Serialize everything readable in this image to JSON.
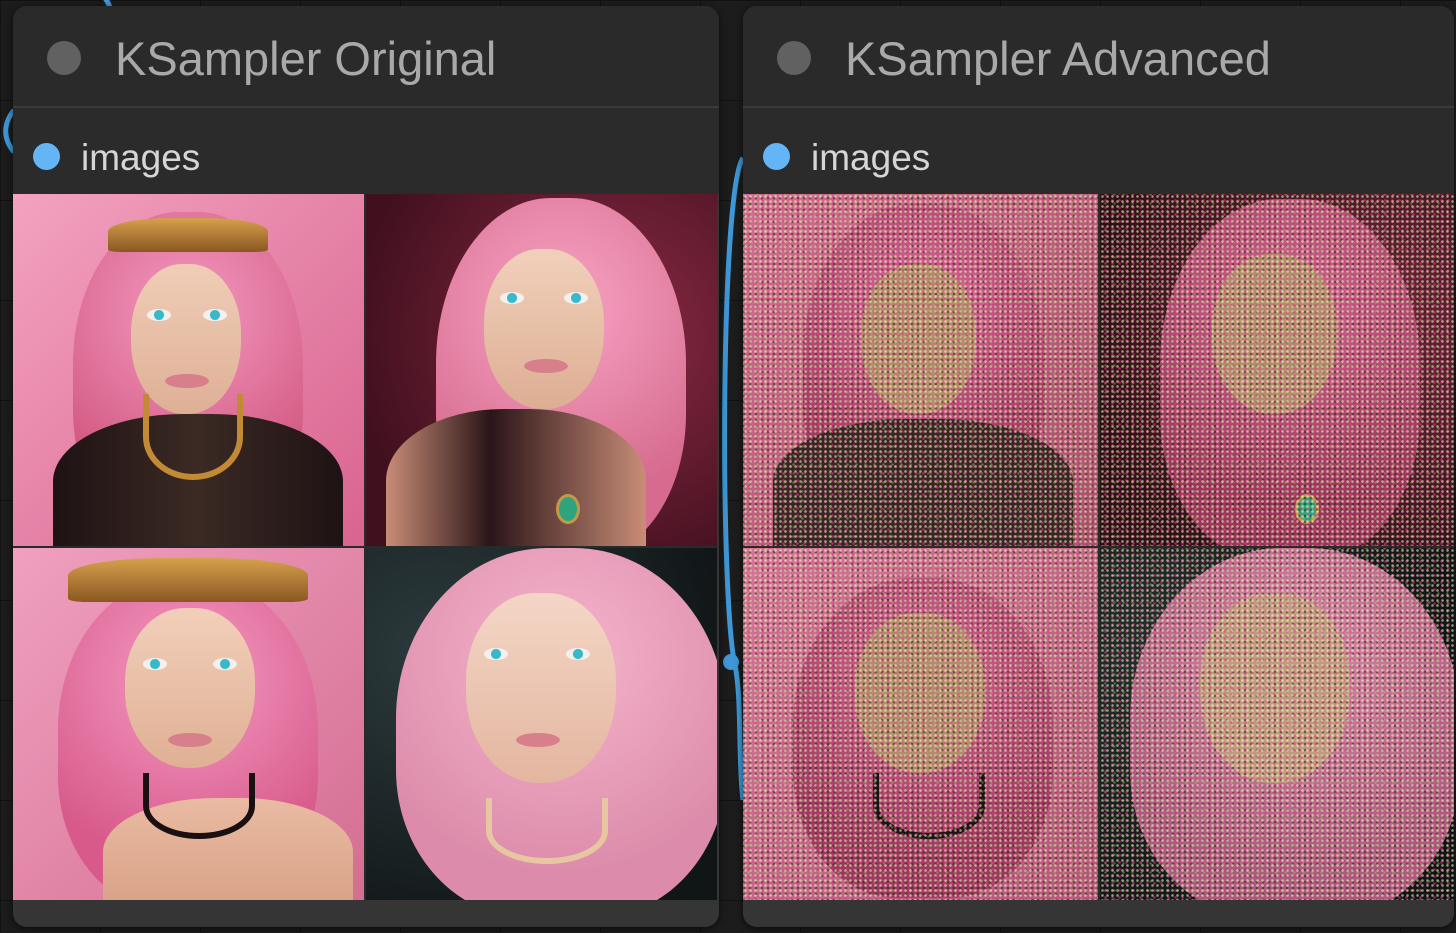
{
  "nodes": [
    {
      "title": "KSampler Original",
      "output": {
        "label": "images"
      },
      "images": [
        {
          "alt": "Portrait 1 pink hair gold headpiece",
          "noisy": false
        },
        {
          "alt": "Portrait 2 pink wavy hair dark red background",
          "noisy": false
        },
        {
          "alt": "Portrait 3 pink hair jeweled crown",
          "noisy": false
        },
        {
          "alt": "Portrait 4 pastel pink hair dark background",
          "noisy": false
        }
      ]
    },
    {
      "title": "KSampler Advanced",
      "output": {
        "label": "images"
      },
      "images": [
        {
          "alt": "Noisy portrait 1",
          "noisy": true
        },
        {
          "alt": "Noisy portrait 2",
          "noisy": true
        },
        {
          "alt": "Noisy portrait 3",
          "noisy": true
        },
        {
          "alt": "Noisy portrait 4",
          "noisy": true
        }
      ]
    }
  ],
  "colors": {
    "canvas_bg": "#1c1c1c",
    "node_bg": "#353535",
    "node_header": "#2a2a2a",
    "title_text": "#a9a9a9",
    "output_dot": "#64b5f6",
    "link": "#3f97d6"
  }
}
